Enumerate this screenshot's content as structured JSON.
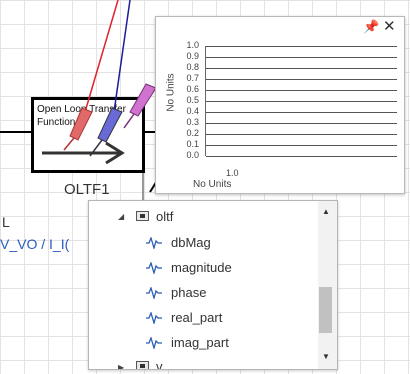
{
  "block": {
    "title": "Open Loop Transfer Function",
    "name": "OLTF1",
    "left_text": "L",
    "signal_label": "V_VO / I_I("
  },
  "plot": {
    "y_ticks": [
      "1.0",
      "0.9",
      "0.8",
      "0.7",
      "0.6",
      "0.5",
      "0.4",
      "0.3",
      "0.2",
      "0.1",
      "0.0"
    ],
    "y_axis_label": "No Units",
    "x_tick": "1.0",
    "x_axis_label": "No Units",
    "pin_icon": "pin-icon",
    "close_label": "✕"
  },
  "tree": {
    "parent": "oltf",
    "items": [
      "dbMag",
      "magnitude",
      "phase",
      "real_part",
      "imag_part"
    ],
    "next_parent": "v"
  },
  "colors": {
    "probe_red": "#e06a6a",
    "probe_blue": "#6a6ad6",
    "probe_pink": "#d072d0",
    "wire_red": "#e0222a",
    "wire_blue": "#1c1c9c",
    "link_blue": "#2a5cb8"
  }
}
